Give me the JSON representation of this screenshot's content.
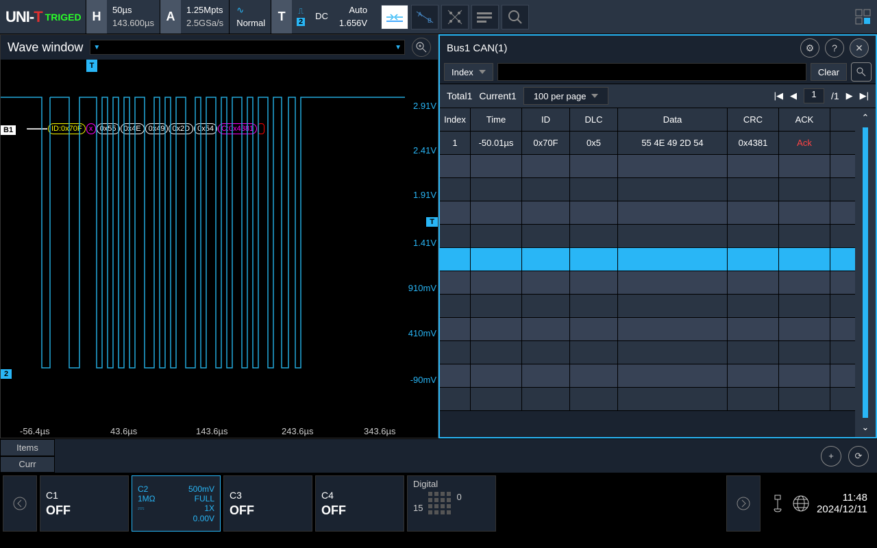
{
  "logo": {
    "brand": "UNI-T",
    "status": "TRIGED"
  },
  "top": {
    "h": {
      "badge": "H",
      "v1": "50µs",
      "v2": "143.600µs"
    },
    "a": {
      "badge": "A",
      "v1": "1.25Mpts",
      "v2": "2.5GSa/s",
      "mode": "Normal"
    },
    "t": {
      "badge": "T",
      "coupling": "DC",
      "ch": "2",
      "mode": "Auto",
      "level": "1.656V"
    }
  },
  "wave": {
    "title": "Wave window",
    "y_labels": [
      "2.91V",
      "2.41V",
      "1.91V",
      "1.41V",
      "910mV",
      "410mV",
      "-90mV"
    ],
    "x_labels": [
      "-56.4µs",
      "43.6µs",
      "143.6µs",
      "243.6µs",
      "343.6µs"
    ],
    "trig_marker": "T",
    "ch_marker": "2",
    "t_top": "T",
    "b_marker": "B1",
    "decode": {
      "id": "ID:0x70F",
      "x": "x",
      "d": [
        "0x55",
        "0x4E",
        "0x49",
        "0x2D",
        "0x54"
      ],
      "crc": "C:0x4381"
    }
  },
  "decode": {
    "title": "Bus1 CAN(1)",
    "filter_label": "Index",
    "clear": "Clear",
    "total": "Total1",
    "current": "Current1",
    "per_page": "100 per page",
    "page": "1",
    "pages": "/1",
    "headers": [
      "Index",
      "Time",
      "ID",
      "DLC",
      "Data",
      "CRC",
      "ACK"
    ],
    "rows": [
      {
        "idx": "1",
        "time": "-50.01µs",
        "id": "0x70F",
        "dlc": "0x5",
        "data": "55 4E 49 2D 54",
        "crc": "0x4381",
        "ack": "Ack"
      }
    ]
  },
  "items": {
    "tab1": "Items",
    "tab2": "Curr"
  },
  "channels": {
    "c1": {
      "name": "C1",
      "state": "OFF"
    },
    "c2": {
      "name": "C2",
      "scale": "500mV",
      "imp": "1MΩ",
      "bw": "FULL",
      "probe": "1X",
      "offset": "0.00V"
    },
    "c3": {
      "name": "C3",
      "state": "OFF"
    },
    "c4": {
      "name": "C4",
      "state": "OFF"
    },
    "digital": {
      "name": "Digital",
      "n0": "0",
      "n15": "15"
    }
  },
  "datetime": {
    "time": "11:48",
    "date": "2024/12/11"
  }
}
